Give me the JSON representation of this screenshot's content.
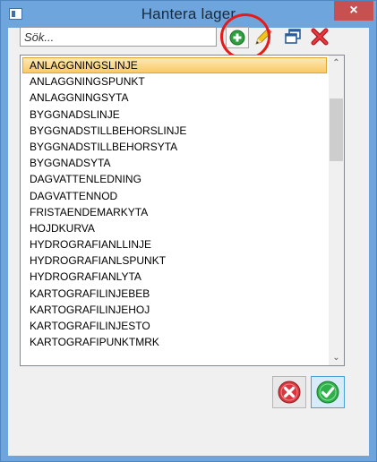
{
  "window": {
    "title": "Hantera lager",
    "close_glyph": "×"
  },
  "toolbar": {
    "search_placeholder": "Sök...",
    "icons": [
      "add-icon",
      "edit-pencil-icon",
      "duplicate-icon",
      "delete-icon"
    ]
  },
  "layers": {
    "selected_index": 0,
    "items": [
      "ANLAGGNINGSLINJE",
      "ANLAGGNINGSPUNKT",
      "ANLAGGNINGSYTA",
      "BYGGNADSLINJE",
      "BYGGNADSTILLBEHORSLINJE",
      "BYGGNADSTILLBEHORSYTA",
      "BYGGNADSYTA",
      "DAGVATTENLEDNING",
      "DAGVATTENNOD",
      "FRISTAENDEMARKYTA",
      "HOJDKURVA",
      "HYDROGRAFIANLLINJE",
      "HYDROGRAFIANLSPUNKT",
      "HYDROGRAFIANLYTA",
      "KARTOGRAFILINJEBEB",
      "KARTOGRAFILINJEHOJ",
      "KARTOGRAFILINJESTO",
      "KARTOGRAFIPUNKTMRK"
    ]
  },
  "scrollbar": {
    "up_glyph": "⌃",
    "down_glyph": "⌄"
  },
  "colors": {
    "window_frame": "#6fa5dd",
    "close_button": "#c75050",
    "highlight_ring": "#e41b1b",
    "selection": "#f9c966",
    "ok_green": "#2fb14a",
    "cancel_red": "#d9363e"
  }
}
